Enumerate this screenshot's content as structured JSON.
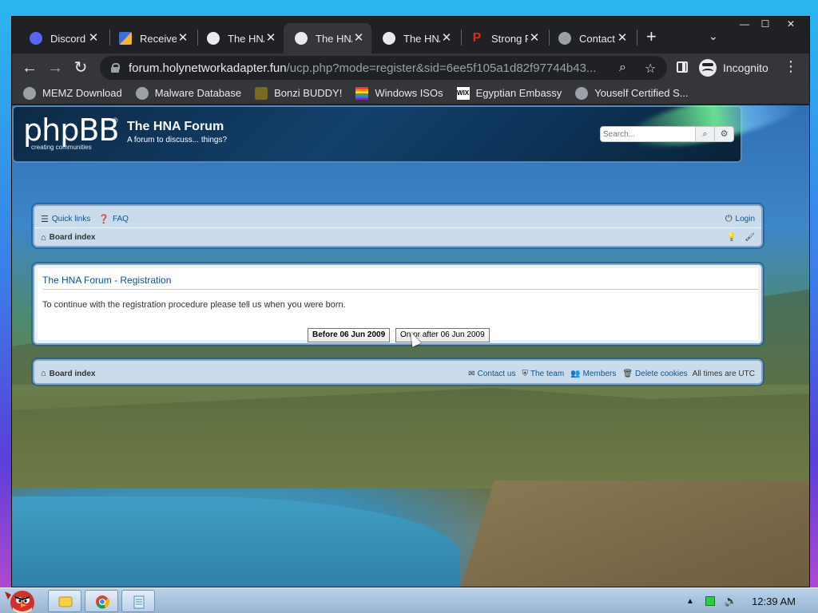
{
  "browser": {
    "tabs": [
      {
        "title": "Discord",
        "favicon_color": "#5865f2"
      },
      {
        "title": "Receive",
        "favicon_color": "#f2b632"
      },
      {
        "title": "The HNA",
        "favicon_color": "#e8eaed"
      },
      {
        "title": "The HNA",
        "favicon_color": "#e8eaed",
        "active": true
      },
      {
        "title": "The HNA",
        "favicon_color": "#e8eaed"
      },
      {
        "title": "Strong P",
        "favicon_color": "#e0281c"
      },
      {
        "title": "Contact",
        "favicon_color": "#9aa0a6"
      }
    ],
    "url_host": "forum.holynetworkadapter.fun",
    "url_path": "/ucp.php?mode=register&sid=6ee5f105a1d82f97744b43...",
    "profile_label": "Incognito",
    "bookmarks": [
      {
        "label": "MEMZ Download",
        "icon_color": "#9aa0a6"
      },
      {
        "label": "Malware Database",
        "icon_color": "#9aa0a6"
      },
      {
        "label": "Bonzi BUDDY!",
        "icon_color": "#7a6a1f"
      },
      {
        "label": "Windows ISOs",
        "icon_color": "#e04a9a"
      },
      {
        "label": "Egyptian Embassy",
        "icon_color": "#ffffff"
      },
      {
        "label": "Youself Certified S...",
        "icon_color": "#9aa0a6"
      }
    ]
  },
  "forum": {
    "logo_text": "phpBB",
    "logo_tagline": "creating   communities",
    "title": "The HNA Forum",
    "description": "A forum to discuss... things?",
    "search_placeholder": "Search...",
    "nav": {
      "quick_links": "Quick links",
      "faq": "FAQ",
      "login": "Login",
      "board_index": "Board index"
    },
    "registration": {
      "title": "The HNA Forum - Registration",
      "message": "To continue with the registration procedure please tell us when you were born.",
      "before_button": "Before 06 Jun 2009",
      "after_button": "On or after 06 Jun 2009"
    },
    "footer": {
      "board_index": "Board index",
      "contact_us": "Contact us",
      "the_team": "The team",
      "members": "Members",
      "delete_cookies": "Delete cookies",
      "timezone": "All times are UTC"
    }
  },
  "taskbar": {
    "clock": "12:39 AM"
  }
}
